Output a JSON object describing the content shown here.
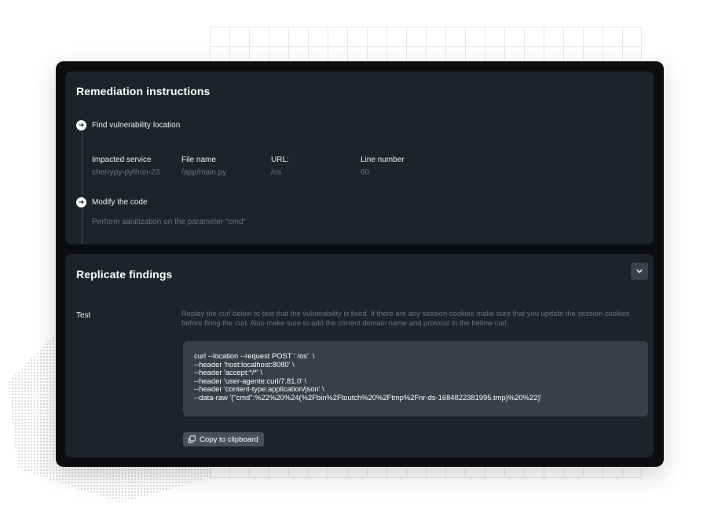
{
  "remediation": {
    "title": "Remediation instructions",
    "steps": [
      {
        "icon": "arrow-right-circle-icon",
        "label": "Find vulnerability location"
      },
      {
        "icon": "arrow-right-circle-icon",
        "label": "Modify the code"
      }
    ],
    "location": {
      "impacted_service": {
        "label": "Impacted service",
        "value": "cherrypy-python-23"
      },
      "file_name": {
        "label": "File name",
        "value": "/app/main.py"
      },
      "url": {
        "label": "URL:",
        "value": "/os"
      },
      "line_number": {
        "label": "Line number",
        "value": "60"
      }
    },
    "modify_description": "Perform sanitization on the parameter \"cmd\""
  },
  "replicate": {
    "title": "Replicate findings",
    "collapse_icon": "chevron-down-icon",
    "test_label": "Test",
    "test_description": "Replay the curl below to test that the vulnerability is fixed. If there are any session cookies make sure that you update the session cookies before firing the curl. Also make sure to add the correct domain name and protocol in the bellow curl.",
    "code_lines": [
      "curl --location --request POST ' /os'  \\",
      "--header 'host:localhost:8080' \\",
      "--header 'accept:*/*' \\",
      "--header 'user-agente:curl/7.81.0' \\",
      "--header 'content-type:application/json' \\",
      "--data-raw '{\"cmd\":%22%20%24(%2Fbin%2Ftoutch%20%2Ftmp%2Fnr-ds-1684822381995.tmp)%20%22}'"
    ],
    "copy_button_label": "Copy to clipboard",
    "copy_icon": "copy-icon"
  },
  "colors": {
    "window_bg": "#0b0d0f",
    "card_bg": "#1f2329",
    "code_bg": "#3a3f47",
    "muted_text": "#6c737c"
  }
}
